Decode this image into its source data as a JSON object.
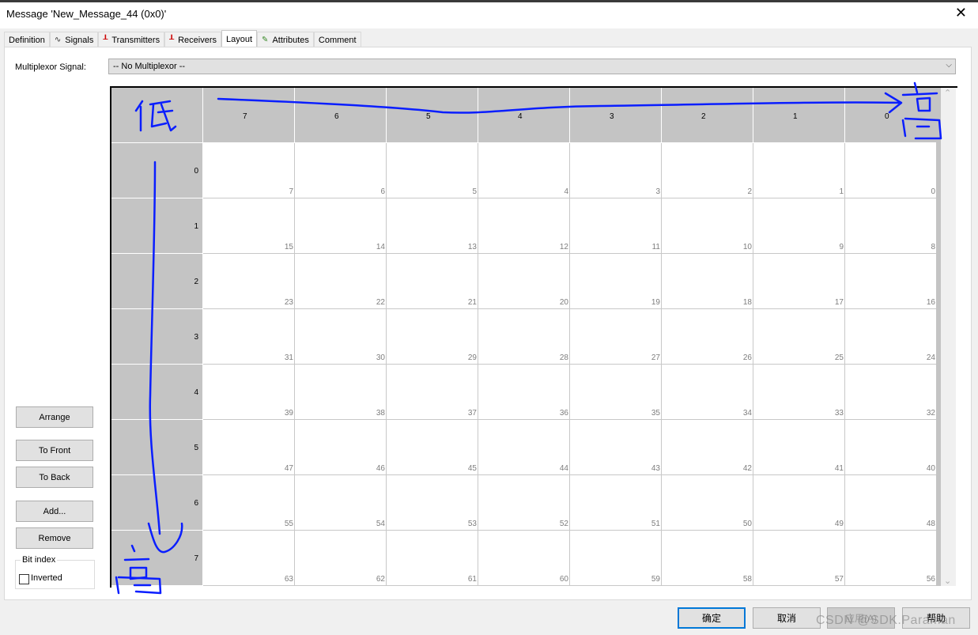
{
  "window": {
    "title": "Message 'New_Message_44 (0x0)'",
    "close_icon": "close-icon"
  },
  "tabs": [
    {
      "label": "Definition",
      "icon": ""
    },
    {
      "label": "Signals",
      "icon": "signal-wave-icon"
    },
    {
      "label": "Transmitters",
      "icon": "node-icon"
    },
    {
      "label": "Receivers",
      "icon": "node-icon"
    },
    {
      "label": "Layout",
      "icon": "",
      "active": true
    },
    {
      "label": "Attributes",
      "icon": "pencil-icon"
    },
    {
      "label": "Comment",
      "icon": ""
    }
  ],
  "multiplexor": {
    "label": "Multiplexor Signal:",
    "value": "-- No Multiplexor --"
  },
  "grid": {
    "column_headers": [
      "7",
      "6",
      "5",
      "4",
      "3",
      "2",
      "1",
      "0"
    ],
    "row_headers": [
      "0",
      "1",
      "2",
      "3",
      "4",
      "5",
      "6",
      "7"
    ],
    "bits": [
      [
        "7",
        "6",
        "5",
        "4",
        "3",
        "2",
        "1",
        "0"
      ],
      [
        "15",
        "14",
        "13",
        "12",
        "11",
        "10",
        "9",
        "8"
      ],
      [
        "23",
        "22",
        "21",
        "20",
        "19",
        "18",
        "17",
        "16"
      ],
      [
        "31",
        "30",
        "29",
        "28",
        "27",
        "26",
        "25",
        "24"
      ],
      [
        "39",
        "38",
        "37",
        "36",
        "35",
        "34",
        "33",
        "32"
      ],
      [
        "47",
        "46",
        "45",
        "44",
        "43",
        "42",
        "41",
        "40"
      ],
      [
        "55",
        "54",
        "53",
        "52",
        "51",
        "50",
        "49",
        "48"
      ],
      [
        "63",
        "62",
        "61",
        "60",
        "59",
        "58",
        "57",
        "56"
      ]
    ],
    "row_header_color": "#c4c4c4"
  },
  "side_buttons": {
    "arrange": "Arrange",
    "to_front": "To Front",
    "to_back": "To Back",
    "add": "Add...",
    "remove": "Remove"
  },
  "bit_index": {
    "legend": "Bit index",
    "inverted_label": "Inverted",
    "inverted_checked": false
  },
  "dialog_buttons": {
    "ok": "确定",
    "cancel": "取消",
    "apply": "应用(A)",
    "help": "帮助"
  },
  "annotations": {
    "low": "低",
    "high_top": "高",
    "high_bottom": "高",
    "ink_color": "#0a1eff"
  },
  "watermark": "CSDN @SDK.Paraman"
}
